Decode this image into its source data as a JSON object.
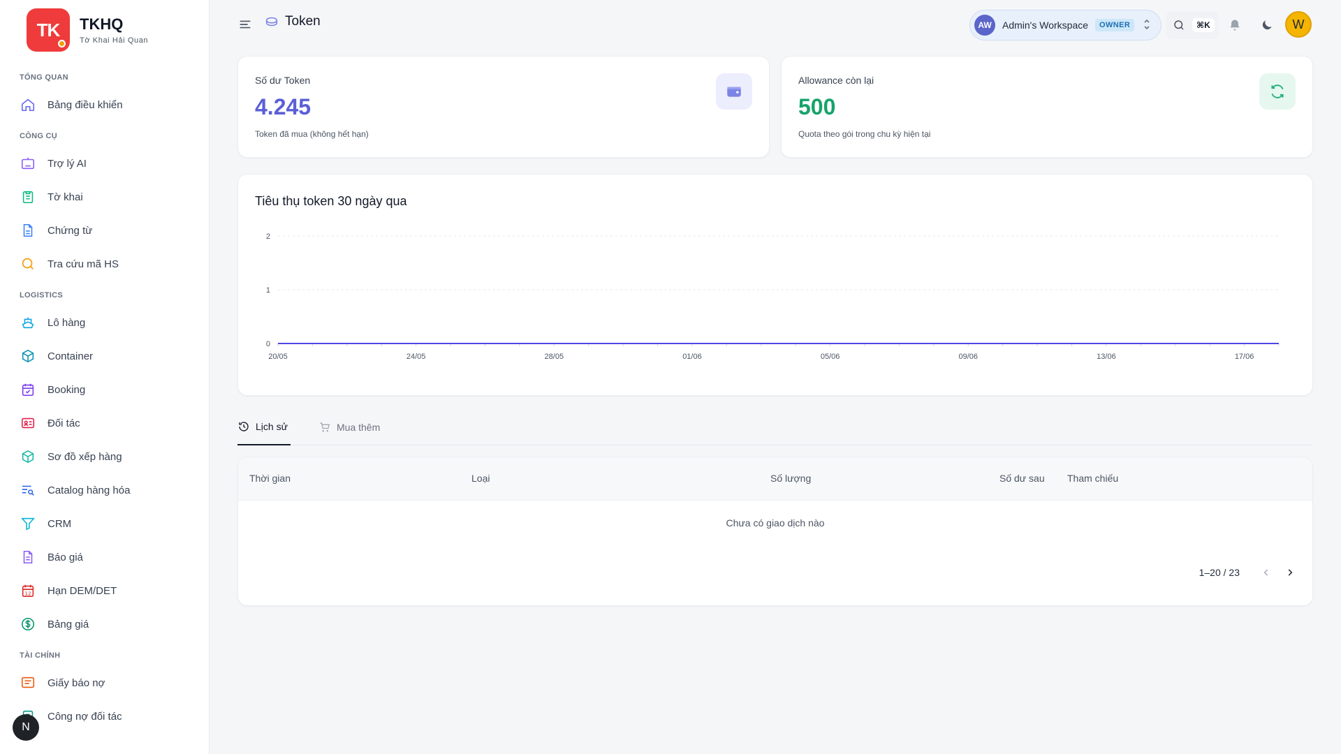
{
  "brand": {
    "logo_text": "TK",
    "title": "TKHQ",
    "subtitle": "Tờ Khai Hải Quan"
  },
  "sidebar": {
    "sections": [
      {
        "title": "TỔNG QUAN",
        "items": [
          {
            "label": "Bảng điều khiển",
            "icon": "home-icon"
          }
        ]
      },
      {
        "title": "CÔNG CỤ",
        "items": [
          {
            "label": "Trợ lý AI",
            "icon": "robot-icon"
          },
          {
            "label": "Tờ khai",
            "icon": "clipboard-icon"
          },
          {
            "label": "Chứng từ",
            "icon": "document-icon"
          },
          {
            "label": "Tra cứu mã HS",
            "icon": "search-icon"
          }
        ]
      },
      {
        "title": "LOGISTICS",
        "items": [
          {
            "label": "Lô hàng",
            "icon": "ship-icon"
          },
          {
            "label": "Container",
            "icon": "box-icon"
          },
          {
            "label": "Booking",
            "icon": "calendar-check-icon"
          },
          {
            "label": "Đối tác",
            "icon": "id-card-icon"
          },
          {
            "label": "Sơ đồ xếp hàng",
            "icon": "cube-icon"
          },
          {
            "label": "Catalog hàng hóa",
            "icon": "list-search-icon"
          },
          {
            "label": "CRM",
            "icon": "filter-icon"
          },
          {
            "label": "Báo giá",
            "icon": "file-text-icon"
          },
          {
            "label": "Hạn DEM/DET",
            "icon": "calendar-12-icon"
          },
          {
            "label": "Bảng giá",
            "icon": "dollar-circle-icon"
          }
        ]
      },
      {
        "title": "TÀI CHÍNH",
        "items": [
          {
            "label": "Giấy báo nợ",
            "icon": "message-lines-icon"
          },
          {
            "label": "Công nợ đối tác",
            "icon": "ledger-icon"
          }
        ]
      }
    ],
    "fab_letter": "N"
  },
  "header": {
    "title": "Token",
    "workspace": {
      "avatar": "AW",
      "name": "Admin's Workspace",
      "role": "OWNER"
    },
    "search_shortcut": "⌘K",
    "user_initial": "W"
  },
  "stats": {
    "balance": {
      "label": "Số dư Token",
      "value": "4.245",
      "sub": "Token đã mua (không hết hạn)",
      "color": "#5b5fd6"
    },
    "allowance": {
      "label": "Allowance còn lại",
      "value": "500",
      "sub": "Quota theo gói trong chu kỳ hiện tại",
      "color": "#16a36a"
    }
  },
  "chart_data": {
    "type": "line",
    "title": "Tiêu thụ token 30 ngày qua",
    "x_labels": [
      "20/05",
      "24/05",
      "28/05",
      "01/06",
      "05/06",
      "09/06",
      "13/06",
      "17/06"
    ],
    "x_total_days": 30,
    "yticks": [
      0,
      1,
      2
    ],
    "ylim": [
      0,
      2
    ],
    "series": [
      {
        "values": [
          0,
          0,
          0,
          0,
          0,
          0,
          0,
          0,
          0,
          0,
          0,
          0,
          0,
          0,
          0,
          0,
          0,
          0,
          0,
          0,
          0,
          0,
          0,
          0,
          0,
          0,
          0,
          0,
          0,
          0
        ],
        "color": "#4f46e5"
      }
    ],
    "grid": true
  },
  "tabs": [
    {
      "label": "Lịch sử",
      "icon": "history-icon",
      "active": true
    },
    {
      "label": "Mua thêm",
      "icon": "cart-icon",
      "active": false
    }
  ],
  "table": {
    "columns": [
      "Thời gian",
      "Loại",
      "Số lượng",
      "Số dư sau",
      "Tham chiếu"
    ],
    "empty_text": "Chưa có giao dịch nào",
    "pagination": "1–20 / 23"
  }
}
